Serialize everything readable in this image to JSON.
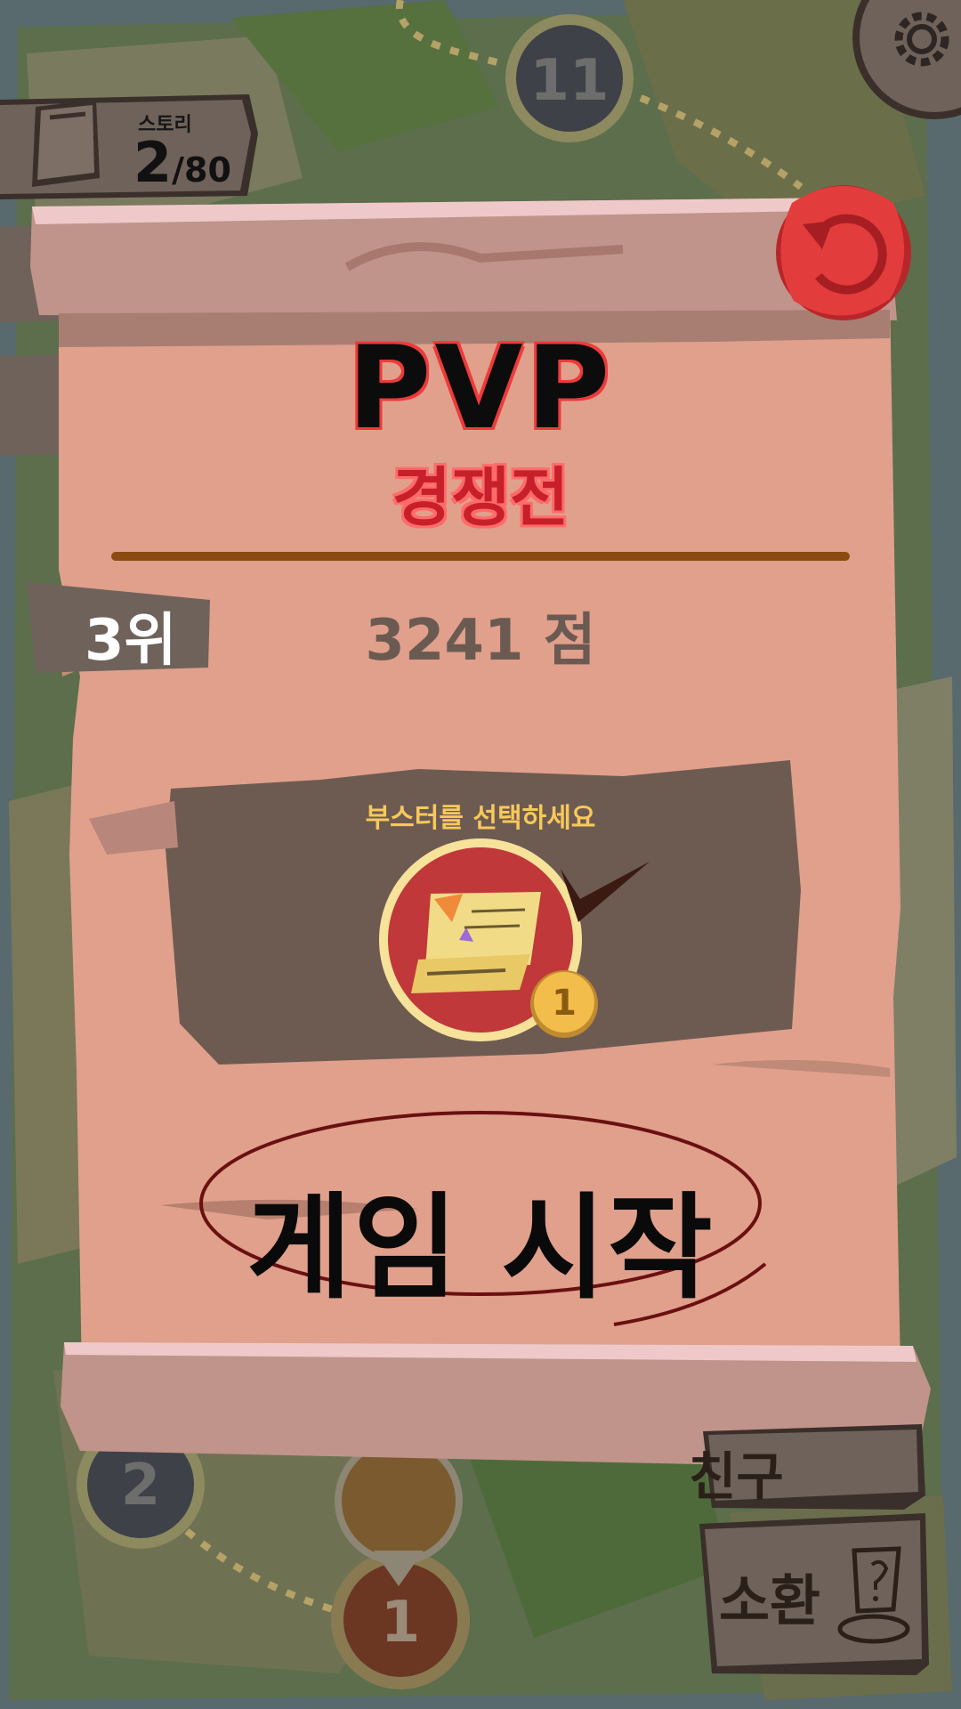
{
  "story": {
    "label": "스토리",
    "current": "2",
    "total": "/80"
  },
  "level_nodes": [
    {
      "number": "11",
      "state": "locked"
    },
    {
      "number": "2",
      "state": "locked"
    },
    {
      "number": "1",
      "state": "current"
    }
  ],
  "pvp_panel": {
    "title": "PVP",
    "subtitle": "경쟁전",
    "rank": "3위",
    "score": "3241 점",
    "booster_prompt": "부스터를 선택하세요",
    "booster_count": "1",
    "start_button": "게임 시작"
  },
  "side_buttons": {
    "friend": "친구",
    "summon": "소환"
  },
  "colors": {
    "parchment": "#e0a08c",
    "board": "#6d5b52",
    "title_outline": "#ee3a3a",
    "subtitle": "#c8202a",
    "divider": "#8a4a10",
    "booster_prompt": "#f7c95b",
    "booster_circle": "#c0383a",
    "close_seal": "#e33c3c"
  },
  "icons": {
    "settings": "gear-icon",
    "close": "undo-arrow-icon",
    "story": "book-icon",
    "booster": "scroll-icon",
    "summon": "mystery-box-icon"
  }
}
